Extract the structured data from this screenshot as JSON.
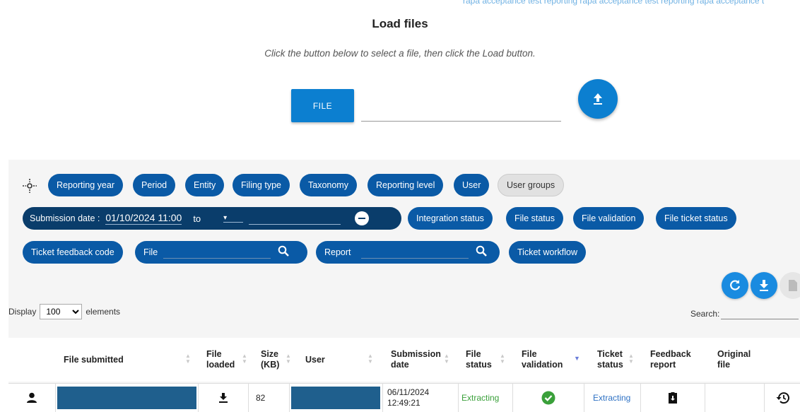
{
  "header": {
    "marquee": "rapa acceptance test reporting rapa acceptance test reporting rapa acceptance t",
    "title": "Load files",
    "instruction": "Click the button below to select a file, then click the Load button.",
    "file_button_label": "FILE"
  },
  "filters": {
    "row1": [
      "Reporting year",
      "Period",
      "Entity",
      "Filing type",
      "Taxonomy",
      "Reporting level",
      "User",
      "User groups"
    ],
    "submission": {
      "label": "Submission date :",
      "value": "01/10/2024 11:00",
      "to_label": "to",
      "caret": "▾"
    },
    "row2": [
      "Integration status",
      "File status",
      "File validation",
      "File ticket status"
    ],
    "ticket_feedback_code": "Ticket feedback code",
    "file_search_label": "File",
    "report_search_label": "Report",
    "ticket_workflow": "Ticket workflow"
  },
  "table_controls": {
    "display_prefix": "Display",
    "display_value": "100",
    "display_suffix": "elements",
    "search_label": "Search:"
  },
  "columns": {
    "file_submitted": "File submitted",
    "file_loaded": "File loaded",
    "size": "Size (KB)",
    "user": "User",
    "submission_date": "Submission date",
    "file_status": "File status",
    "file_validation": "File validation",
    "ticket_status": "Ticket status",
    "feedback_report": "Feedback report",
    "original_file": "Original file"
  },
  "rows": [
    {
      "size": "82",
      "date": "06/11/2024",
      "time": "12:49:21",
      "file_status": "Extracting",
      "ticket_status": "Extracting"
    }
  ],
  "colors": {
    "primary": "#0c7fd0",
    "chip": "#0a5aa6",
    "chip_dark": "#0a3d6b",
    "success": "#3aa03a",
    "link": "#2f72c4"
  },
  "icons": {
    "upload": "upload-icon",
    "settings": "filter-settings-icon",
    "refresh": "refresh-icon",
    "download": "download-icon",
    "export": "document-icon",
    "user": "person-icon",
    "history": "history-icon"
  }
}
